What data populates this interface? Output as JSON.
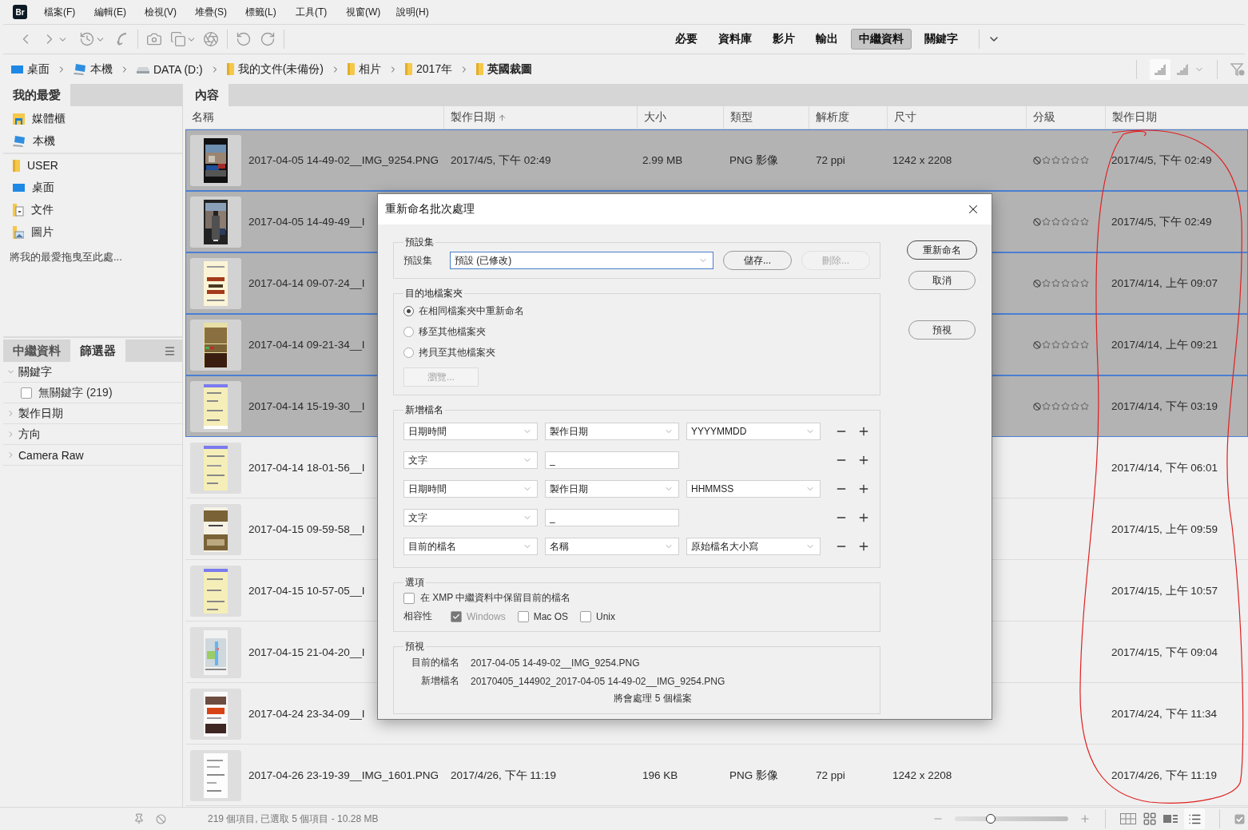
{
  "app_logo": "Br",
  "menu": [
    "檔案(F)",
    "編輯(E)",
    "檢視(V)",
    "堆疊(S)",
    "標籤(L)",
    "工具(T)",
    "視窗(W)",
    "說明(H)"
  ],
  "workspaces": [
    {
      "label": "必要",
      "selected": false
    },
    {
      "label": "資料庫",
      "selected": false
    },
    {
      "label": "影片",
      "selected": false
    },
    {
      "label": "輸出",
      "selected": false
    },
    {
      "label": "中繼資料",
      "selected": true
    },
    {
      "label": "關鍵字",
      "selected": false
    }
  ],
  "breadcrumb": [
    {
      "label": "桌面",
      "kind": "desktop",
      "current": false
    },
    {
      "label": "本機",
      "kind": "computer",
      "current": false
    },
    {
      "label": "DATA (D:)",
      "kind": "drive",
      "current": false
    },
    {
      "label": "我的文件(未備份)",
      "kind": "folder",
      "current": false
    },
    {
      "label": "相片",
      "kind": "folder",
      "current": false
    },
    {
      "label": "2017年",
      "kind": "folder",
      "current": false
    },
    {
      "label": "英國裁圖",
      "kind": "folder",
      "current": true
    }
  ],
  "favorites": {
    "tab": "我的最愛",
    "places": [
      {
        "label": "媒體櫃",
        "kind": "library"
      },
      {
        "label": "本機",
        "kind": "computer"
      }
    ],
    "folders": [
      {
        "label": "USER",
        "kind": "folder"
      },
      {
        "label": "桌面",
        "kind": "desktop"
      },
      {
        "label": "文件",
        "kind": "documents"
      },
      {
        "label": "圖片",
        "kind": "pictures"
      }
    ],
    "hint": "將我的最愛拖曳至此處..."
  },
  "filter_panel": {
    "tabs": [
      {
        "label": "中繼資料",
        "selected": false
      },
      {
        "label": "篩選器",
        "selected": true
      }
    ],
    "groups": [
      {
        "label": "關鍵字",
        "expanded": true,
        "children": [
          {
            "label": "無關鍵字 (219)",
            "checked": false
          }
        ]
      },
      {
        "label": "製作日期",
        "expanded": false
      },
      {
        "label": "方向",
        "expanded": false
      },
      {
        "label": "Camera Raw",
        "expanded": false
      }
    ]
  },
  "content": {
    "tab": "內容",
    "columns": [
      {
        "label": "名稱",
        "sorted": false
      },
      {
        "label": "製作日期",
        "sorted": true
      },
      {
        "label": "大小",
        "sorted": false
      },
      {
        "label": "類型",
        "sorted": false
      },
      {
        "label": "解析度",
        "sorted": false
      },
      {
        "label": "尺寸",
        "sorted": false
      },
      {
        "label": "分級",
        "sorted": false
      },
      {
        "label": "製作日期",
        "sorted": false
      }
    ],
    "rows": [
      {
        "name": "2017-04-05 14-49-02__IMG_9254.PNG",
        "created": "2017/4/5, 下午 02:49",
        "size": "2.99 MB",
        "type": "PNG 影像",
        "resolution": "72 ppi",
        "dimensions": "1242 x 2208",
        "stars": 0,
        "date": "2017/4/5, 下午 02:49",
        "selected": true
      },
      {
        "name": "2017-04-05 14-49-49__I",
        "stars": 0,
        "date": "2017/4/5, 下午 02:49",
        "selected": true
      },
      {
        "name": "2017-04-14 09-07-24__I",
        "stars": 0,
        "date": "2017/4/14, 上午 09:07",
        "selected": true
      },
      {
        "name": "2017-04-14 09-21-34__I",
        "stars": 0,
        "date": "2017/4/14, 上午 09:21",
        "selected": true
      },
      {
        "name": "2017-04-14 15-19-30__I",
        "stars": 0,
        "date": "2017/4/14, 下午 03:19",
        "selected": true
      },
      {
        "name": "2017-04-14 18-01-56__I",
        "date": "2017/4/14, 下午 06:01",
        "selected": false
      },
      {
        "name": "2017-04-15 09-59-58__I",
        "date": "2017/4/15, 上午 09:59",
        "selected": false
      },
      {
        "name": "2017-04-15 10-57-05__I",
        "date": "2017/4/15, 上午 10:57",
        "selected": false
      },
      {
        "name": "2017-04-15 21-04-20__I",
        "date": "2017/4/15, 下午 09:04",
        "selected": false
      },
      {
        "name": "2017-04-24 23-34-09__I",
        "date": "2017/4/24, 下午 11:34",
        "selected": false
      },
      {
        "name": "2017-04-26 23-19-39__IMG_1601.PNG",
        "created": "2017/4/26, 下午 11:19",
        "size": "196 KB",
        "type": "PNG 影像",
        "resolution": "72 ppi",
        "dimensions": "1242 x 2208",
        "date": "2017/4/26, 下午 11:19",
        "selected": false
      }
    ]
  },
  "dialog": {
    "title": "重新命名批次處理",
    "preset": {
      "title": "預設集",
      "label": "預設集",
      "value": "預設 (已修改)",
      "buttons": [
        {
          "label": "儲存...",
          "disabled": false
        },
        {
          "label": "刪除...",
          "disabled": true
        }
      ]
    },
    "destination": {
      "title": "目的地檔案夾",
      "options": [
        {
          "label": "在相同檔案夾中重新命名",
          "selected": true
        },
        {
          "label": "移至其他檔案夾",
          "selected": false
        },
        {
          "label": "拷貝至其他檔案夾",
          "selected": false
        }
      ],
      "browse": {
        "label": "瀏覽...",
        "disabled": true
      }
    },
    "new_name": {
      "title": "新增檔名",
      "rows": [
        {
          "fields": [
            {
              "kind": "select",
              "value": "日期時間"
            },
            {
              "kind": "select",
              "value": "製作日期"
            },
            {
              "kind": "select",
              "value": "YYYYMMDD"
            }
          ]
        },
        {
          "fields": [
            {
              "kind": "select",
              "value": "文字"
            },
            {
              "kind": "text",
              "value": "_"
            }
          ]
        },
        {
          "fields": [
            {
              "kind": "select",
              "value": "日期時間"
            },
            {
              "kind": "select",
              "value": "製作日期"
            },
            {
              "kind": "select",
              "value": "HHMMSS"
            }
          ]
        },
        {
          "fields": [
            {
              "kind": "select",
              "value": "文字"
            },
            {
              "kind": "text",
              "value": "_"
            }
          ]
        },
        {
          "fields": [
            {
              "kind": "select",
              "value": "目前的檔名"
            },
            {
              "kind": "select",
              "value": "名稱"
            },
            {
              "kind": "select",
              "value": "原始檔名大小寫"
            }
          ]
        }
      ]
    },
    "options": {
      "title": "選項",
      "keep_xmp": {
        "label": "在 XMP 中繼資料中保留目前的檔名",
        "checked": false
      },
      "compat_label": "相容性",
      "compat": [
        {
          "label": "Windows",
          "checked": true,
          "disabled": true
        },
        {
          "label": "Mac OS",
          "checked": false,
          "disabled": false
        },
        {
          "label": "Unix",
          "checked": false,
          "disabled": false
        }
      ]
    },
    "preview": {
      "title": "預視",
      "rows": [
        {
          "label": "目前的檔名",
          "value": "2017-04-05 14-49-02__IMG_9254.PNG"
        },
        {
          "label": "新增檔名",
          "value": "20170405_144902_2017-04-05 14-49-02__IMG_9254.PNG"
        }
      ],
      "note": "將會處理 5 個檔案"
    },
    "buttons": [
      {
        "label": "重新命名",
        "default": true
      },
      {
        "label": "取消",
        "default": false
      },
      {
        "label": "預視",
        "default": false
      }
    ]
  },
  "status_bar": {
    "summary": "219 個項目, 已選取 5 個項目 - 10.28 MB",
    "zoom": {
      "level": 0.32
    }
  }
}
